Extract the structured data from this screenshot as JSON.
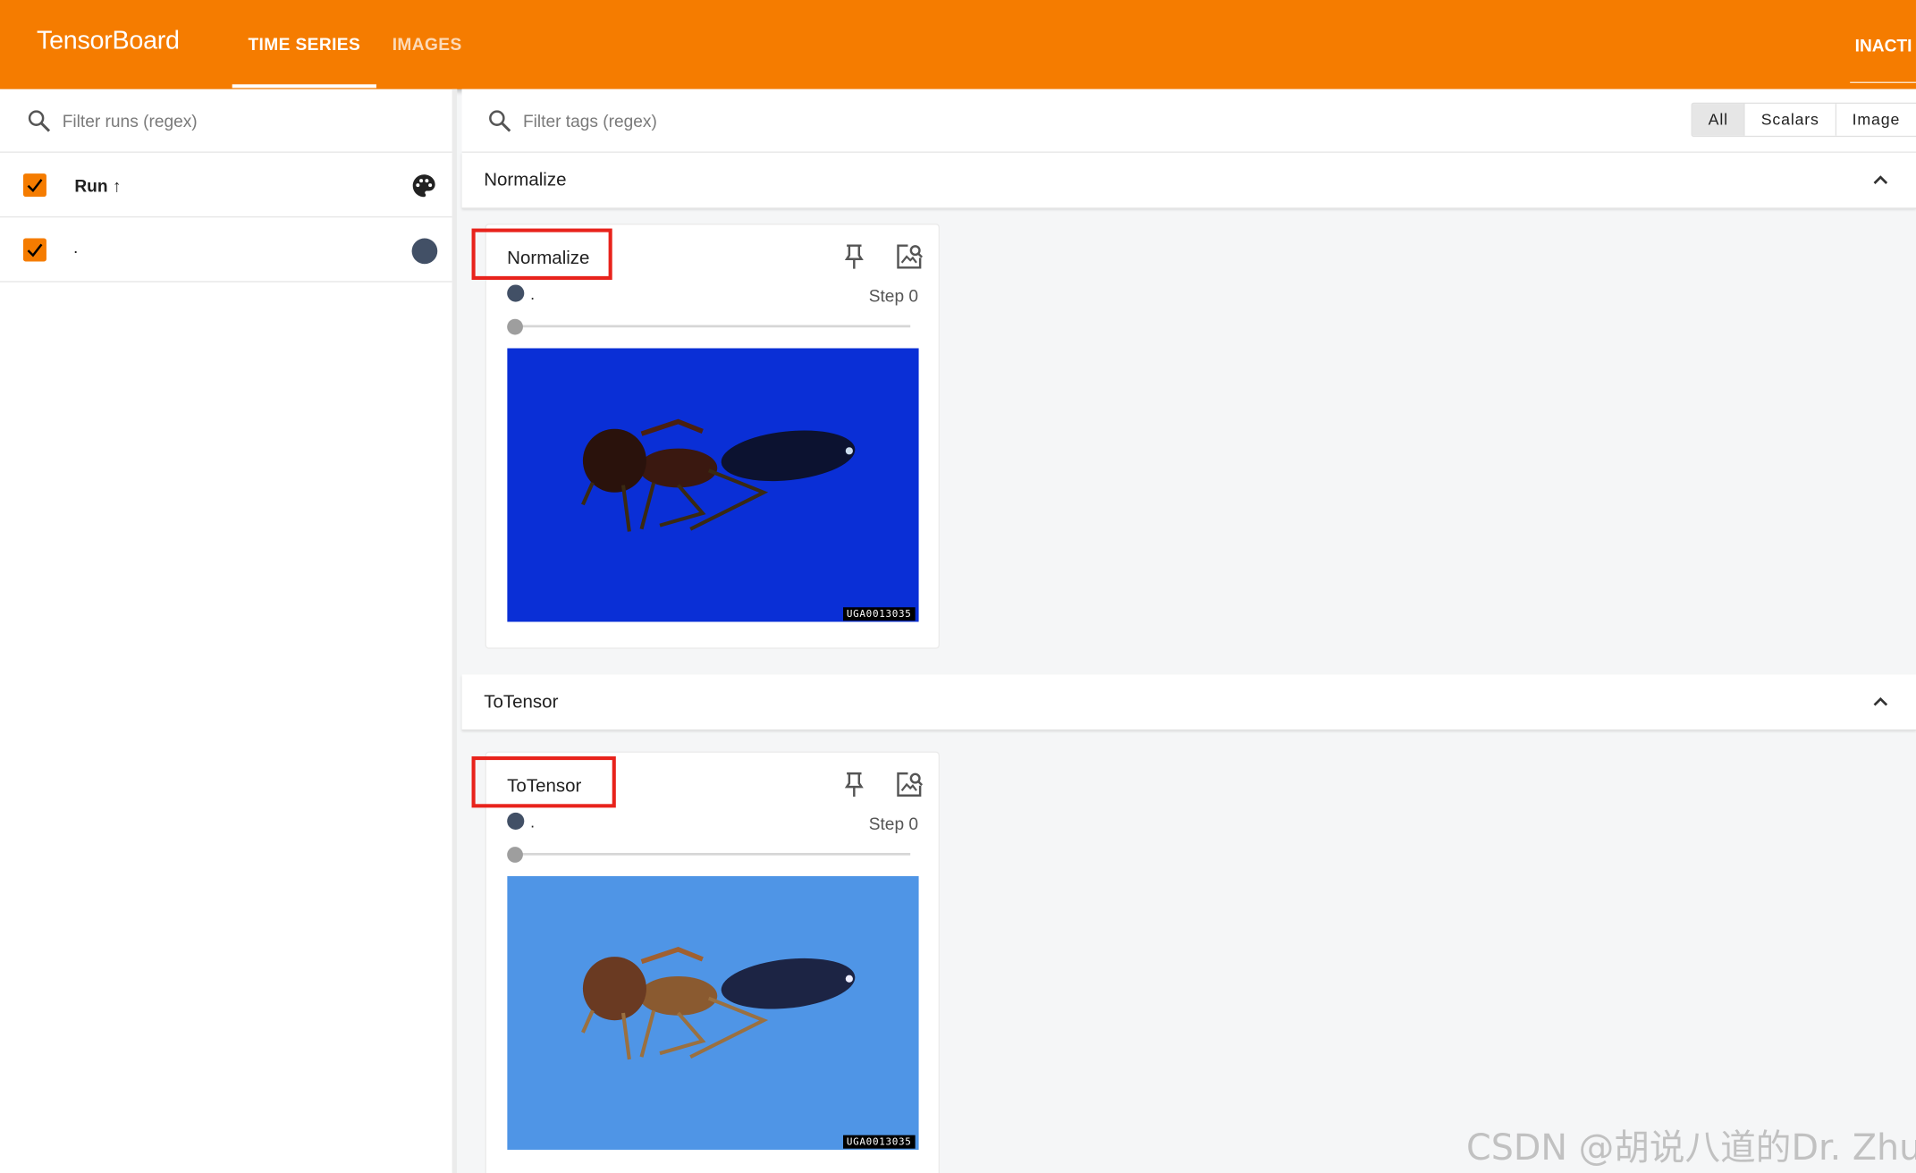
{
  "app": {
    "title": "TensorBoard"
  },
  "tabs": [
    {
      "label": "TIME SERIES",
      "active": true
    },
    {
      "label": "IMAGES",
      "active": false
    }
  ],
  "header_right": {
    "label": "INACTI"
  },
  "colors": {
    "primary": "#f57c00",
    "run_color": "#425066",
    "highlight": "#e8231c",
    "normalized_bg": "#0a2fd6",
    "tensor_bg": "#4f95e6"
  },
  "runs_panel": {
    "search_placeholder": "Filter runs (regex)",
    "header_label": "Run ↑",
    "runs": [
      {
        "name": ".",
        "checked": true
      }
    ]
  },
  "main": {
    "search_placeholder": "Filter tags (regex)",
    "type_filters": [
      {
        "label": "All",
        "selected": true
      },
      {
        "label": "Scalars",
        "selected": false
      },
      {
        "label": "Image",
        "selected": false
      }
    ],
    "groups": [
      {
        "name": "Normalize",
        "card": {
          "title": "Normalize",
          "run_label": ".",
          "step_label": "Step 0",
          "slider_value": 0,
          "image_id": "UGA0013035",
          "highlighted": true
        }
      },
      {
        "name": "ToTensor",
        "card": {
          "title": "ToTensor",
          "run_label": ".",
          "step_label": "Step 0",
          "slider_value": 0,
          "image_id": "UGA0013035",
          "highlighted": true
        }
      }
    ]
  },
  "watermark": "CSDN @胡说八道的Dr. Zhu"
}
